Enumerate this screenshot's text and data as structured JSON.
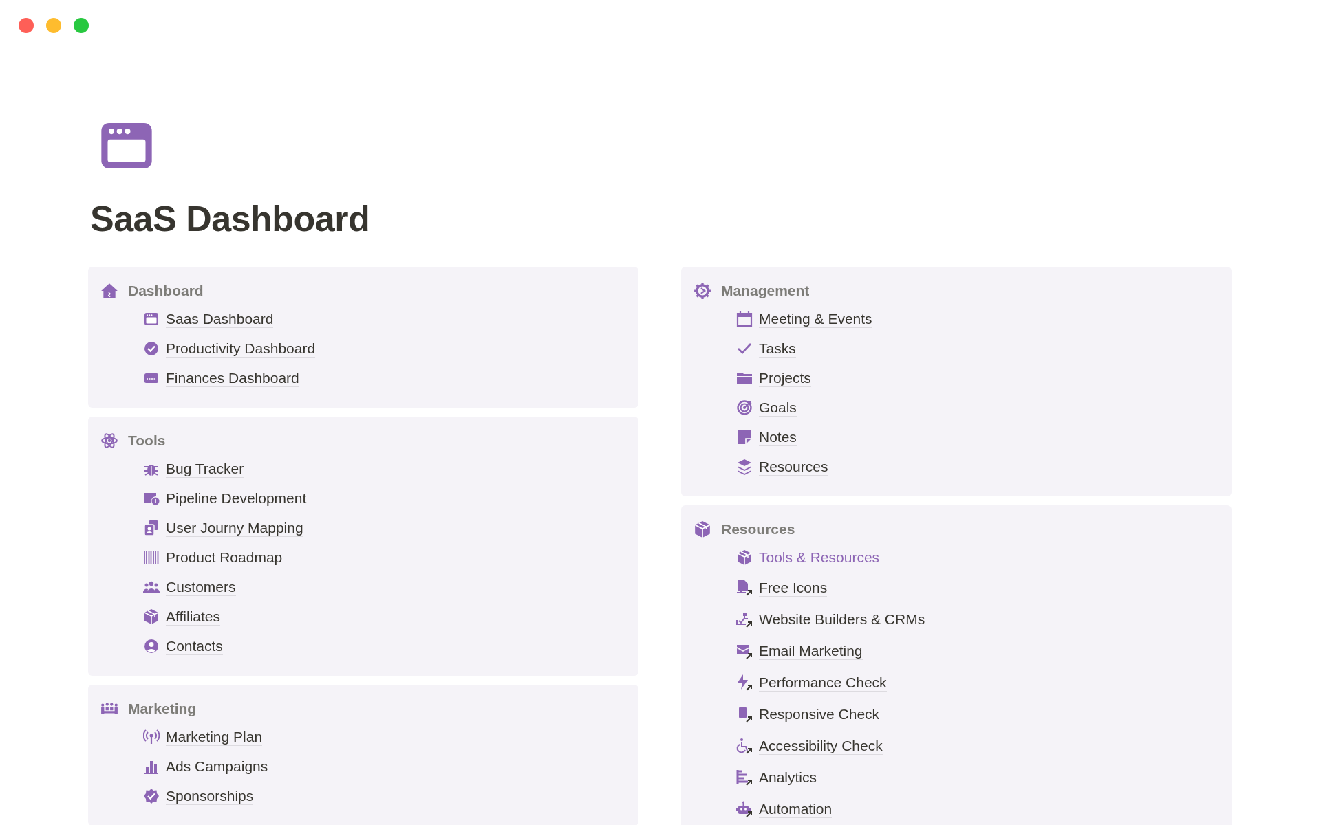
{
  "page": {
    "title": "SaaS Dashboard"
  },
  "columns": [
    {
      "sections": [
        {
          "heading": "Dashboard",
          "items": [
            {
              "label": "Saas Dashboard",
              "kind": "page"
            },
            {
              "label": "Productivity Dashboard",
              "kind": "page"
            },
            {
              "label": "Finances Dashboard",
              "kind": "page"
            }
          ]
        },
        {
          "heading": "Tools",
          "items": [
            {
              "label": "Bug Tracker",
              "kind": "page"
            },
            {
              "label": "Pipeline Development",
              "kind": "page"
            },
            {
              "label": "User Journy Mapping",
              "kind": "page"
            },
            {
              "label": "Product Roadmap",
              "kind": "page"
            },
            {
              "label": "Customers",
              "kind": "page"
            },
            {
              "label": "Affiliates",
              "kind": "page"
            },
            {
              "label": "Contacts",
              "kind": "page"
            }
          ]
        },
        {
          "heading": "Marketing",
          "items": [
            {
              "label": "Marketing Plan",
              "kind": "page"
            },
            {
              "label": "Ads Campaigns",
              "kind": "page"
            },
            {
              "label": "Sponsorships",
              "kind": "page"
            }
          ]
        }
      ]
    },
    {
      "sections": [
        {
          "heading": "Management",
          "items": [
            {
              "label": "Meeting & Events",
              "kind": "page"
            },
            {
              "label": "Tasks",
              "kind": "page"
            },
            {
              "label": "Projects",
              "kind": "page"
            },
            {
              "label": "Goals",
              "kind": "page"
            },
            {
              "label": "Notes",
              "kind": "page"
            },
            {
              "label": "Resources",
              "kind": "page"
            }
          ]
        },
        {
          "heading": "Resources",
          "items": [
            {
              "label": "Tools & Resources",
              "kind": "link"
            },
            {
              "label": "Free Icons",
              "kind": "external"
            },
            {
              "label": "Website Builders & CRMs",
              "kind": "external"
            },
            {
              "label": "Email Marketing",
              "kind": "external"
            },
            {
              "label": "Performance Check",
              "kind": "external"
            },
            {
              "label": "Responsive Check",
              "kind": "external"
            },
            {
              "label": "Accessibility Check",
              "kind": "external"
            },
            {
              "label": "Analytics",
              "kind": "external"
            },
            {
              "label": "Automation",
              "kind": "external"
            }
          ]
        }
      ]
    }
  ]
}
